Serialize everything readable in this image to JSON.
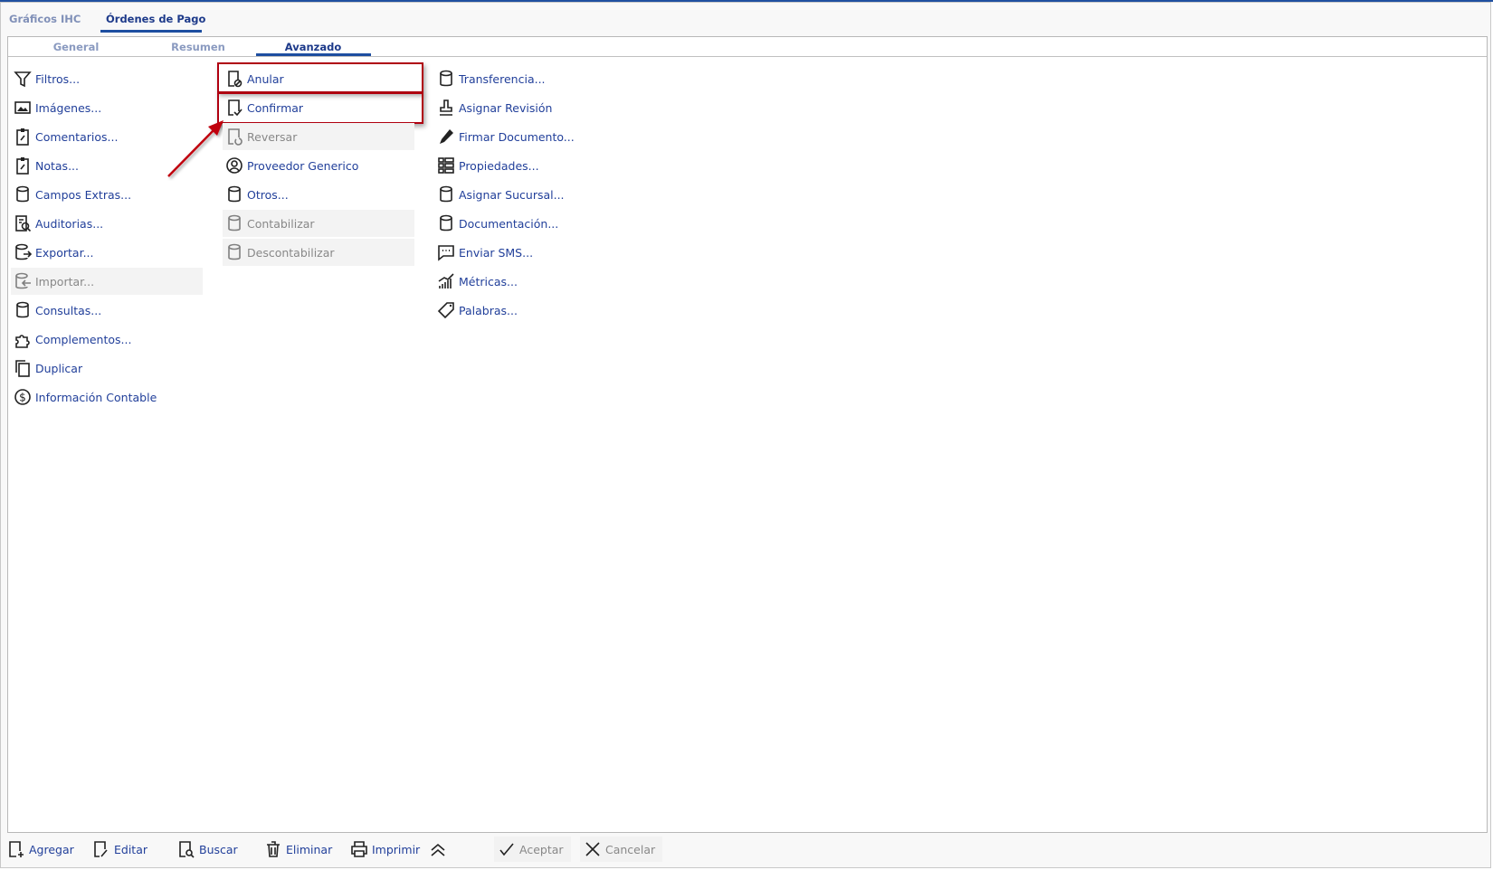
{
  "top_tabs": [
    {
      "label": "Gráficos IHC",
      "active": false
    },
    {
      "label": "Órdenes de Pago",
      "active": true
    }
  ],
  "inner_tabs": [
    {
      "label": "General",
      "active": false
    },
    {
      "label": "Resumen",
      "active": false
    },
    {
      "label": "Avanzado",
      "active": true
    }
  ],
  "columns": [
    [
      {
        "label": "Filtros...",
        "icon": "filter-icon"
      },
      {
        "label": "Imágenes...",
        "icon": "image-icon"
      },
      {
        "label": "Comentarios...",
        "icon": "clipboard-icon"
      },
      {
        "label": "Notas...",
        "icon": "clipboard-icon"
      },
      {
        "label": "Campos Extras...",
        "icon": "database-icon"
      },
      {
        "label": "Auditorias...",
        "icon": "audit-icon"
      },
      {
        "label": "Exportar...",
        "icon": "export-icon"
      },
      {
        "label": "Importar...",
        "icon": "import-icon",
        "disabled": true
      },
      {
        "label": "Consultas...",
        "icon": "database-icon"
      },
      {
        "label": "Complementos...",
        "icon": "puzzle-icon"
      },
      {
        "label": "Duplicar",
        "icon": "duplicate-icon"
      },
      {
        "label": "Información Contable",
        "icon": "dollar-icon"
      }
    ],
    [
      {
        "label": "Anular",
        "icon": "document-cancel-icon",
        "highlighted": true
      },
      {
        "label": "Confirmar",
        "icon": "document-check-icon",
        "highlighted": true
      },
      {
        "label": "Reversar",
        "icon": "document-undo-icon",
        "disabled": true
      },
      {
        "label": "Proveedor Generico",
        "icon": "user-circle-icon"
      },
      {
        "label": "Otros...",
        "icon": "database-icon"
      },
      {
        "label": "Contabilizar",
        "icon": "database-icon",
        "disabled": true
      },
      {
        "label": "Descontabilizar",
        "icon": "database-icon",
        "disabled": true
      }
    ],
    [
      {
        "label": "Transferencia...",
        "icon": "database-icon"
      },
      {
        "label": "Asignar Revisión",
        "icon": "stamp-icon"
      },
      {
        "label": "Firmar Documento...",
        "icon": "pen-icon"
      },
      {
        "label": "Propiedades...",
        "icon": "properties-icon"
      },
      {
        "label": "Asignar Sucursal...",
        "icon": "database-icon"
      },
      {
        "label": "Documentación...",
        "icon": "database-icon"
      },
      {
        "label": "Enviar SMS...",
        "icon": "message-icon"
      },
      {
        "label": "Métricas...",
        "icon": "chart-icon"
      },
      {
        "label": "Palabras...",
        "icon": "tag-icon"
      }
    ]
  ],
  "toolbar": [
    {
      "label": "Agregar",
      "icon": "document-add-icon"
    },
    {
      "label": "Editar",
      "icon": "document-edit-icon"
    },
    {
      "label": "Buscar",
      "icon": "document-search-icon"
    },
    {
      "label": "Eliminar",
      "icon": "trash-icon"
    },
    {
      "label": "Imprimir",
      "icon": "printer-icon"
    }
  ],
  "actions": [
    {
      "label": "Aceptar",
      "icon": "check-icon",
      "disabled": true
    },
    {
      "label": "Cancelar",
      "icon": "close-icon",
      "disabled": true
    }
  ],
  "colors": {
    "link": "#213f9a",
    "accent": "#1d4ea0",
    "highlight": "#b00010"
  }
}
